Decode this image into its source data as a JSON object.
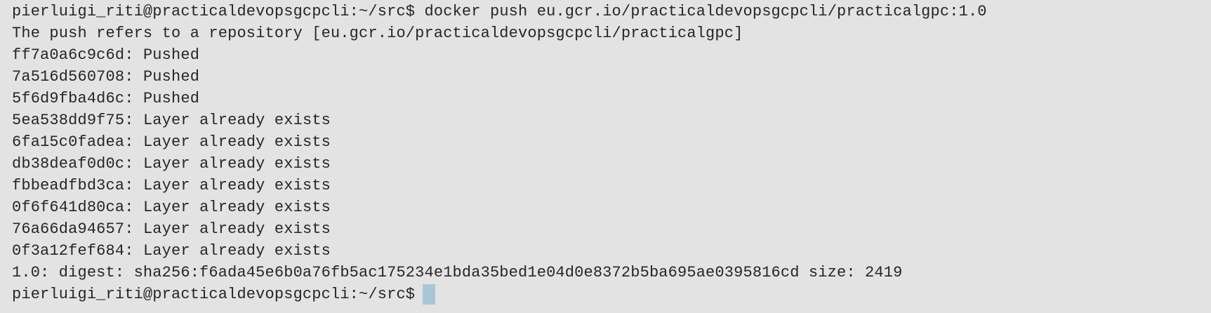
{
  "terminal": {
    "prompt": "pierluigi_riti@practicaldevopsgcpcli:~/src$",
    "command": "docker push eu.gcr.io/practicaldevopsgcpcli/practicalgpc:1.0",
    "push_refers": "The push refers to a repository [eu.gcr.io/practicaldevopsgcpcli/practicalgpc]",
    "layers": [
      {
        "id": "ff7a0a6c9c6d",
        "status": "Pushed"
      },
      {
        "id": "7a516d560708",
        "status": "Pushed"
      },
      {
        "id": "5f6d9fba4d6c",
        "status": "Pushed"
      },
      {
        "id": "5ea538dd9f75",
        "status": "Layer already exists"
      },
      {
        "id": "6fa15c0fadea",
        "status": "Layer already exists"
      },
      {
        "id": "db38deaf0d0c",
        "status": "Layer already exists"
      },
      {
        "id": "fbbeadfbd3ca",
        "status": "Layer already exists"
      },
      {
        "id": "0f6f641d80ca",
        "status": "Layer already exists"
      },
      {
        "id": "76a66da94657",
        "status": "Layer already exists"
      },
      {
        "id": "0f3a12fef684",
        "status": "Layer already exists"
      }
    ],
    "digest_line": "1.0: digest: sha256:f6ada45e6b0a76fb5ac175234e1bda35bed1e04d0e8372b5ba695ae0395816cd size: 2419",
    "final_prompt": "pierluigi_riti@practicaldevopsgcpcli:~/src$"
  }
}
